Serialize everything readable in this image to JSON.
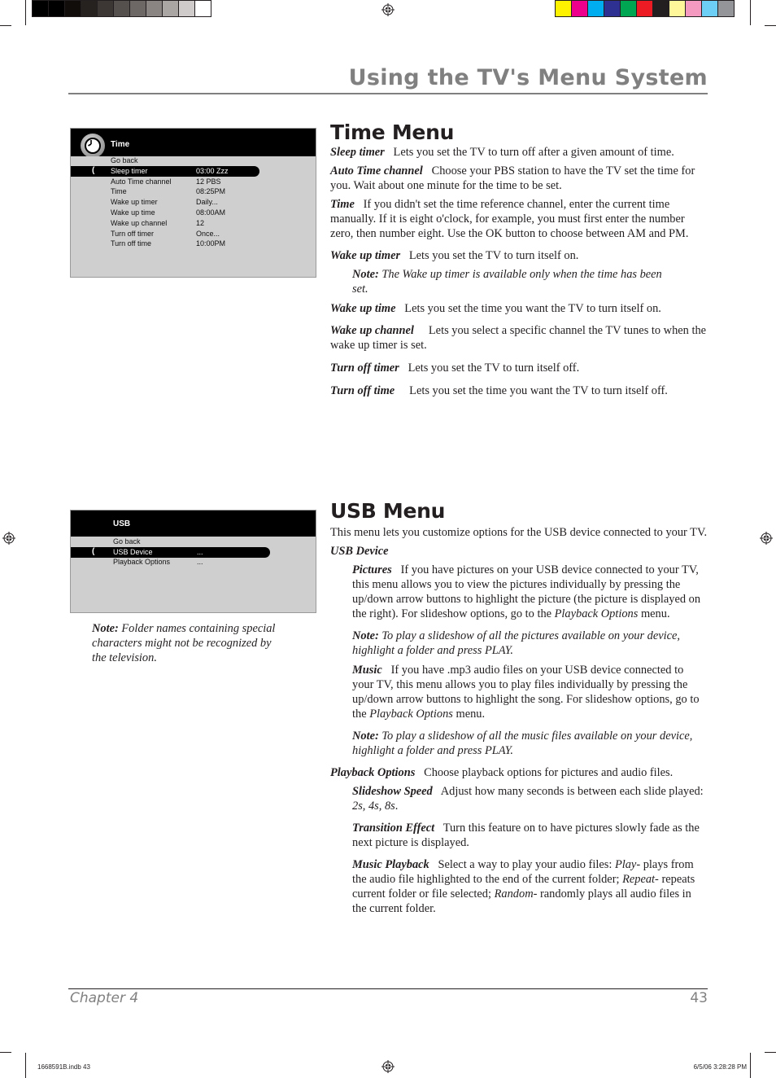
{
  "print_marks": {
    "gray_swatches": [
      "#000000",
      "#000000",
      "#110d0b",
      "#262220",
      "#3c3735",
      "#55504d",
      "#6d6865",
      "#8a8583",
      "#aaa6a4",
      "#cfcbca",
      "#ffffff"
    ],
    "color_swatches": [
      "#fff200",
      "#ec008c",
      "#00aeef",
      "#2e3192",
      "#00a651",
      "#ed1c24",
      "#231f20",
      "#fff799",
      "#f49ac1",
      "#6dcff6",
      "#939598"
    ],
    "slug_left": "1668591B.indb   43",
    "slug_right": "6/5/06   3:28:28 PM"
  },
  "header": {
    "title": "Using the TV's Menu System"
  },
  "colors": {
    "title_gray": "#808080",
    "osd_gray": "#cfcfd0",
    "osd_black": "#000000"
  },
  "time_osd": {
    "title": "Time",
    "icon": "clock-icon",
    "rows": [
      {
        "label": "Go back",
        "value": ""
      },
      {
        "label": "Sleep timer",
        "value": "03:00 Zzz",
        "selected": true
      },
      {
        "label": "Auto Time channel",
        "value": "12 PBS"
      },
      {
        "label": "Time",
        "value": "08:25PM"
      },
      {
        "label": "Wake up timer",
        "value": "Daily..."
      },
      {
        "label": "Wake up time",
        "value": "08:00AM"
      },
      {
        "label": "Wake up channel",
        "value": "12"
      },
      {
        "label": "Turn off timer",
        "value": "Once..."
      },
      {
        "label": "Turn off time",
        "value": "10:00PM"
      }
    ],
    "caret": "("
  },
  "usb_osd": {
    "title": "USB",
    "rows": [
      {
        "label": "Go back",
        "value": ""
      },
      {
        "label": "USB Device",
        "value": "...",
        "selected": true
      },
      {
        "label": "Playback Options",
        "value": "..."
      }
    ],
    "caret": "("
  },
  "time_menu": {
    "heading": "Time Menu",
    "items": [
      {
        "term": "Sleep timer",
        "text": "Lets you set the TV to turn off after a given amount of time."
      },
      {
        "term": "Auto Time channel",
        "text": "Choose your PBS station to have the TV set the time for you. Wait about one minute for the time to be set."
      },
      {
        "term": "Time",
        "text": "If you didn't set the time reference channel, enter the current time manually. If it is eight o'clock, for example, you must first enter the number zero, then number eight. Use the OK button to choose between AM and PM."
      },
      {
        "term": "Wake up timer",
        "text": "Lets you set the TV to turn itself on."
      },
      {
        "term": "Wake up time",
        "text": "Lets you set the time you want the TV to turn itself on."
      },
      {
        "term": "Wake up channel",
        "text": "Lets you select a specific channel the TV tunes to when the wake up timer is set."
      },
      {
        "term": "Turn off timer",
        "text": "Lets you set the TV to turn itself off."
      },
      {
        "term": "Turn off time",
        "text": "Lets you set the time you want the TV to turn itself off."
      }
    ],
    "wake_note": {
      "label": "Note:",
      "text": "The Wake up timer is available only when the time has been set."
    }
  },
  "usb_menu": {
    "heading": "USB Menu",
    "intro": "This menu lets you customize options for the USB device connected to your TV.",
    "usb_device_heading": "USB Device",
    "pictures": {
      "term": "Pictures",
      "text": "If you have pictures on your USB device connected to your TV, this menu allows you to view the pictures individually by pressing the up/down arrow buttons to highlight the picture (the picture is displayed on the right). For slideshow options, go to the",
      "link": "Playback Options",
      "tail": "menu."
    },
    "pictures_note": {
      "label": "Note:",
      "text": "To play a slideshow of all the pictures available on your device, highlight a folder and press PLAY."
    },
    "music": {
      "term": "Music",
      "text": "If you have .mp3 audio files on your USB device connected to your TV, this menu allows you to play files individually by pressing the up/down arrow buttons to highlight the song. For slideshow options, go to the",
      "link": "Playback Options",
      "tail": "menu."
    },
    "music_note": {
      "label": "Note:",
      "text": "To play a slideshow of all the music files available on your device, highlight a folder and press PLAY."
    },
    "playback": {
      "term": "Playback Options",
      "text": "Choose playback options for pictures and audio files."
    },
    "slideshow_speed": {
      "term": "Slideshow Speed",
      "text": "Adjust how many seconds is between each slide played:",
      "values": "2s, 4s, 8s",
      "tail": "."
    },
    "transition": {
      "term": "Transition Effect",
      "text": "Turn this feature on to have pictures slowly fade as the next picture is displayed."
    },
    "music_playback": {
      "term": "Music Playback",
      "text": "Select a way to play your audio files:",
      "opt1": "Play-",
      "opt1_text": "plays from the audio file highlighted to the end of the current folder;",
      "opt2": "Repeat-",
      "opt2_text": "repeats current folder or file selected;",
      "opt3": "Random-",
      "opt3_text": "randomly plays all audio files in the current folder."
    }
  },
  "side_note": {
    "label": "Note:",
    "text": "Folder names containing special characters might not be recognized by the television."
  },
  "footer": {
    "chapter": "Chapter 4",
    "page": "43"
  }
}
